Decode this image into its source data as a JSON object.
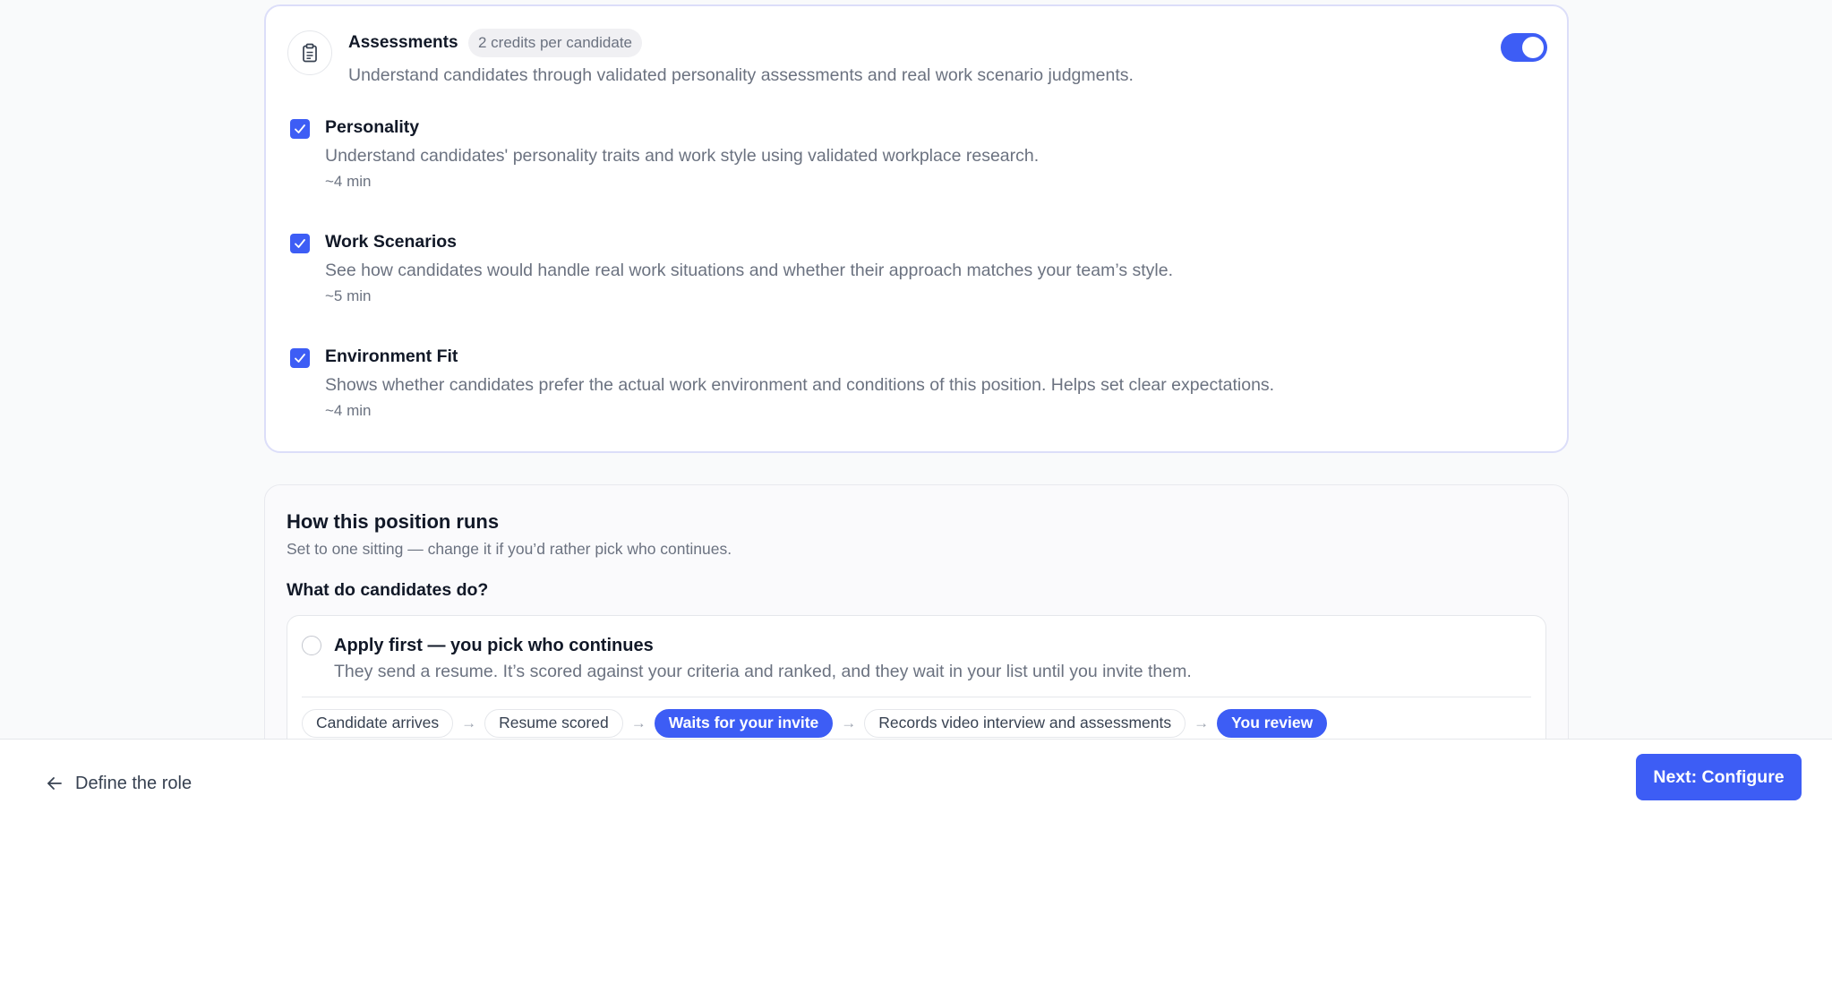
{
  "assessments": {
    "title": "Assessments",
    "credits_badge": "2 credits per candidate",
    "description": "Understand candidates through validated personality assessments and real work scenario judgments.",
    "enabled": true,
    "icon": "clipboard-icon",
    "items": [
      {
        "title": "Personality",
        "description": "Understand candidates' personality traits and work style using validated workplace research.",
        "duration": "~4 min",
        "checked": true
      },
      {
        "title": "Work Scenarios",
        "description": "See how candidates would handle real work situations and whether their approach matches your team’s style.",
        "duration": "~5 min",
        "checked": true
      },
      {
        "title": "Environment Fit",
        "description": "Shows whether candidates prefer the actual work environment and conditions of this position. Helps set clear expectations.",
        "duration": "~4 min",
        "checked": true
      }
    ]
  },
  "runs": {
    "title": "How this position runs",
    "subtitle": "Set to one sitting — change it if you’d rather pick who continues.",
    "question": "What do candidates do?",
    "option": {
      "title": "Apply first — you pick who continues",
      "description": "They send a resume. It’s scored against your criteria and ranked, and they wait in your list until you invite them.",
      "selected": false,
      "flow": [
        {
          "label": "Candidate arrives",
          "active": false
        },
        {
          "label": "Resume scored",
          "active": false
        },
        {
          "label": "Waits for your invite",
          "active": true
        },
        {
          "label": "Records video interview and assessments",
          "active": false
        },
        {
          "label": "You review",
          "active": true
        }
      ],
      "arrow": "→"
    }
  },
  "footer": {
    "back_label": "Define the role",
    "next_label": "Next: Configure"
  },
  "colors": {
    "accent": "#3d5df5",
    "muted_text": "#6b7280"
  }
}
